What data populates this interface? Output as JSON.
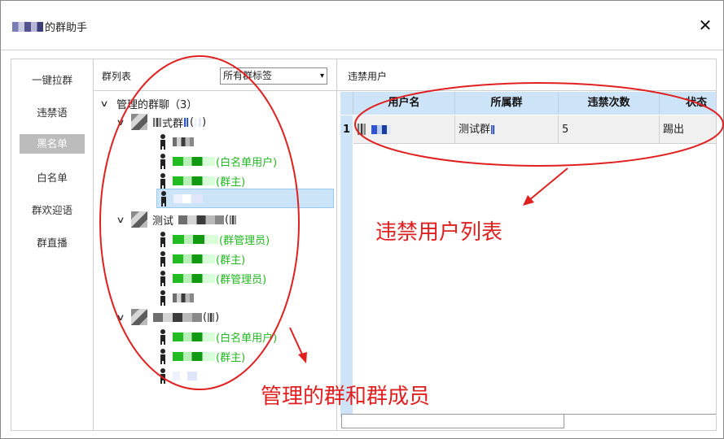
{
  "window": {
    "title_suffix": "的群助手",
    "close_glyph": "✕"
  },
  "nav": {
    "items": [
      {
        "label": "一键拉群"
      },
      {
        "label": "违禁语"
      },
      {
        "label": "黑名单"
      },
      {
        "label": "白名单"
      },
      {
        "label": "群欢迎语"
      },
      {
        "label": "群直播"
      }
    ],
    "active": "黑名单"
  },
  "group_panel": {
    "header": "群列表",
    "tag_filter": {
      "selected": "所有群标签",
      "arrow": "▾"
    },
    "root": {
      "label": "管理的群聊（3）",
      "chevron": "∨"
    },
    "groups": [
      {
        "label_pre": "",
        "label_mid": "式群",
        "label_post": "(",
        "label_end": ")",
        "members": [
          {
            "label": "",
            "tag": "",
            "color": "dark",
            "selected": false
          },
          {
            "label": "",
            "tag": "(白名单用户)",
            "color": "green",
            "selected": false
          },
          {
            "label": "",
            "tag": "(群主)",
            "color": "green",
            "selected": false
          },
          {
            "label": "",
            "tag": "",
            "color": "dark",
            "selected": true
          }
        ]
      },
      {
        "label_pre": "测试",
        "label_mid": "",
        "label_post": "(",
        "label_end": ")",
        "members": [
          {
            "label": "",
            "tag": "(群管理员)",
            "color": "green",
            "selected": false
          },
          {
            "label": "",
            "tag": "(群主)",
            "color": "green",
            "selected": false
          },
          {
            "label": "",
            "tag": "(群管理员)",
            "color": "green",
            "selected": false
          },
          {
            "label": "",
            "tag": "",
            "color": "dark",
            "selected": false
          }
        ]
      },
      {
        "label_pre": "",
        "label_mid": "",
        "label_post": "(",
        "label_end": ")",
        "members": [
          {
            "label": "",
            "tag": "(白名单用户)",
            "color": "green",
            "selected": false
          },
          {
            "label": "",
            "tag": "(群主)",
            "color": "green",
            "selected": false
          },
          {
            "label": "",
            "tag": "",
            "color": "dark",
            "selected": false
          }
        ]
      }
    ]
  },
  "blocked_panel": {
    "header": "违禁用户",
    "columns": [
      "用户名",
      "所属群",
      "违禁次数",
      "状态"
    ],
    "rows": [
      {
        "num": "1",
        "username": "",
        "group": "测试群",
        "count": "5",
        "status": "踢出"
      }
    ]
  },
  "annotations": {
    "blocked_list": "违禁用户列表",
    "groups_and_members": "管理的群和群成员",
    "color": "#e02020"
  },
  "colors": {
    "nav_active_bg": "#bcbcbc",
    "grid_header_bg": "#cde4f8",
    "member_role_text": "#22b822",
    "selection_bg": "#cce4f7"
  }
}
